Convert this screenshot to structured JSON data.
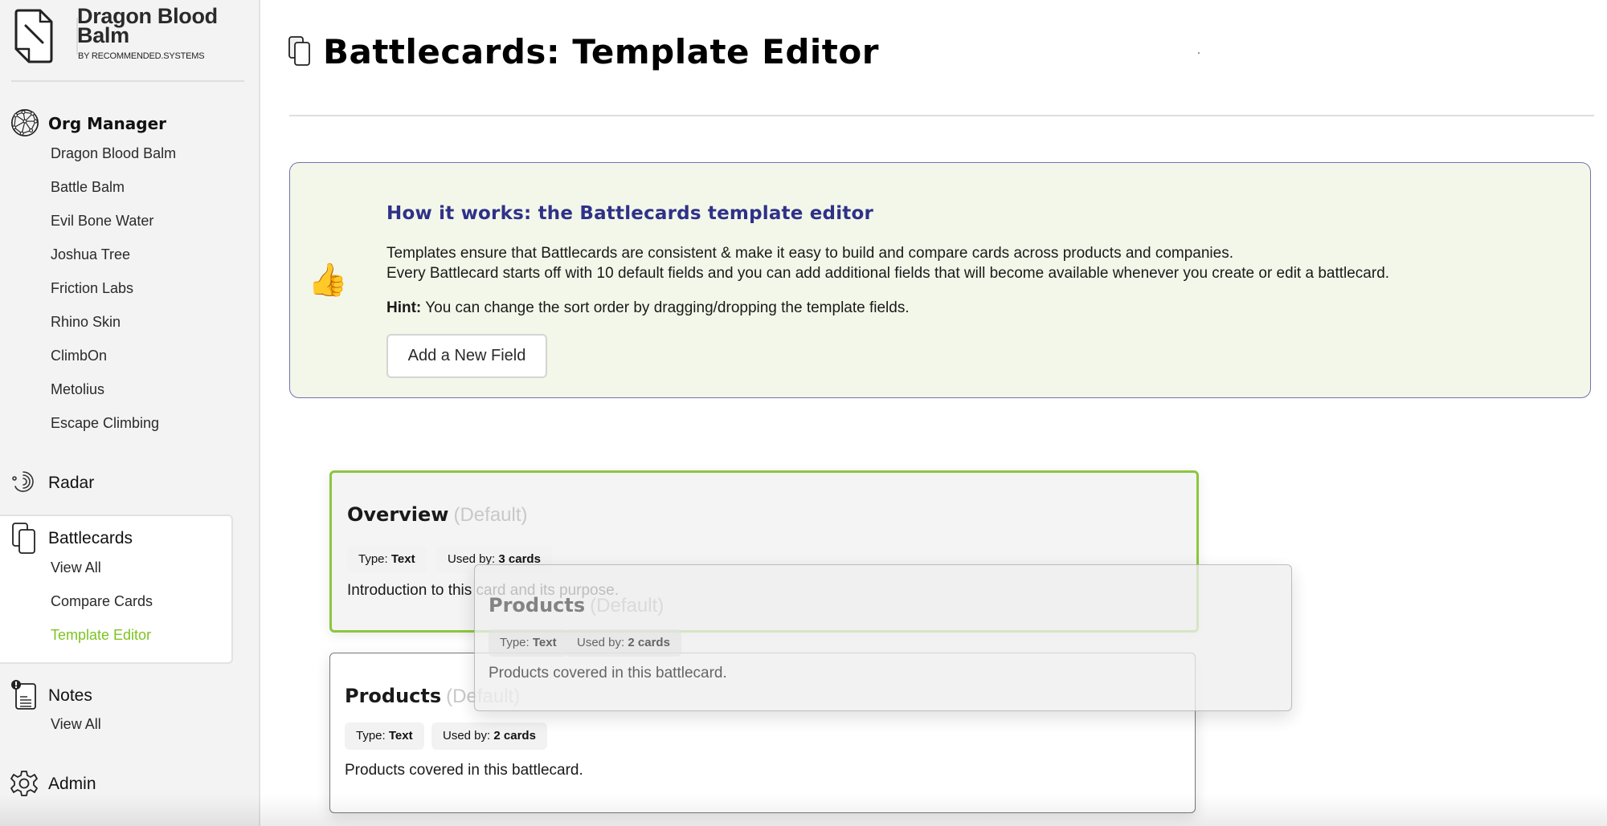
{
  "brand": {
    "name": "Dragon Blood Balm",
    "subtitle": "BY RECOMMENDED.SYSTEMS",
    "logo_icon": "document-icon"
  },
  "sidebar": {
    "org_manager": {
      "label": "Org Manager",
      "icon": "network-globe-icon",
      "items": [
        {
          "label": "Dragon Blood Balm"
        },
        {
          "label": "Battle Balm"
        },
        {
          "label": "Evil Bone Water"
        },
        {
          "label": "Joshua Tree"
        },
        {
          "label": "Friction Labs"
        },
        {
          "label": "Rhino Skin"
        },
        {
          "label": "ClimbOn"
        },
        {
          "label": "Metolius"
        },
        {
          "label": "Escape Climbing"
        }
      ]
    },
    "radar": {
      "label": "Radar",
      "icon": "radar-icon"
    },
    "battlecards": {
      "label": "Battlecards",
      "icon": "cards-icon",
      "items": [
        {
          "label": "View All",
          "active": false
        },
        {
          "label": "Compare Cards",
          "active": false
        },
        {
          "label": "Template Editor",
          "active": true
        }
      ]
    },
    "notes": {
      "label": "Notes",
      "icon": "notes-alert-icon",
      "items": [
        {
          "label": "View All"
        }
      ]
    },
    "admin": {
      "label": "Admin",
      "icon": "gear-icon"
    }
  },
  "page": {
    "title": "Battlecards: Template Editor",
    "title_icon": "cards-icon"
  },
  "info": {
    "icon": "thumbs-up-icon",
    "icon_glyph": "👍",
    "title": "How it works: the Battlecards template editor",
    "line1": "Templates ensure that Battlecards are consistent & make it easy to build and compare cards across products and companies.",
    "line2": "Every Battlecard starts off with 10 default fields and you can add additional fields that will become available whenever you create or edit a battlecard.",
    "hint_label": "Hint:",
    "hint_text": " You can change the sort order by dragging/dropping the template fields.",
    "add_button": "Add a New Field"
  },
  "fields": [
    {
      "name": "Overview",
      "default_label": "(Default)",
      "type_label": "Type: ",
      "type_value": "Text",
      "used_label": "Used by: ",
      "used_value": "3 cards",
      "description": "Introduction to this card and its purpose.",
      "state": "drop-target"
    },
    {
      "name": "Products",
      "default_label": "(Default)",
      "type_label": "Type: ",
      "type_value": "Text",
      "used_label": "Used by: ",
      "used_value": "2 cards",
      "description": "Products covered in this battlecard.",
      "state": "normal"
    }
  ],
  "dragging": {
    "name": "Products",
    "default_label": "(Default)",
    "type_label": "Type: ",
    "type_value": "Text",
    "used_label": "Used by: ",
    "used_value": "2 cards",
    "description": "Products covered in this battlecard."
  },
  "colors": {
    "accent_green": "#7ec322",
    "drop_border": "#8cc63f",
    "info_bg": "#f3f7e9",
    "info_border": "#7173b0",
    "info_title": "#2f3188"
  }
}
